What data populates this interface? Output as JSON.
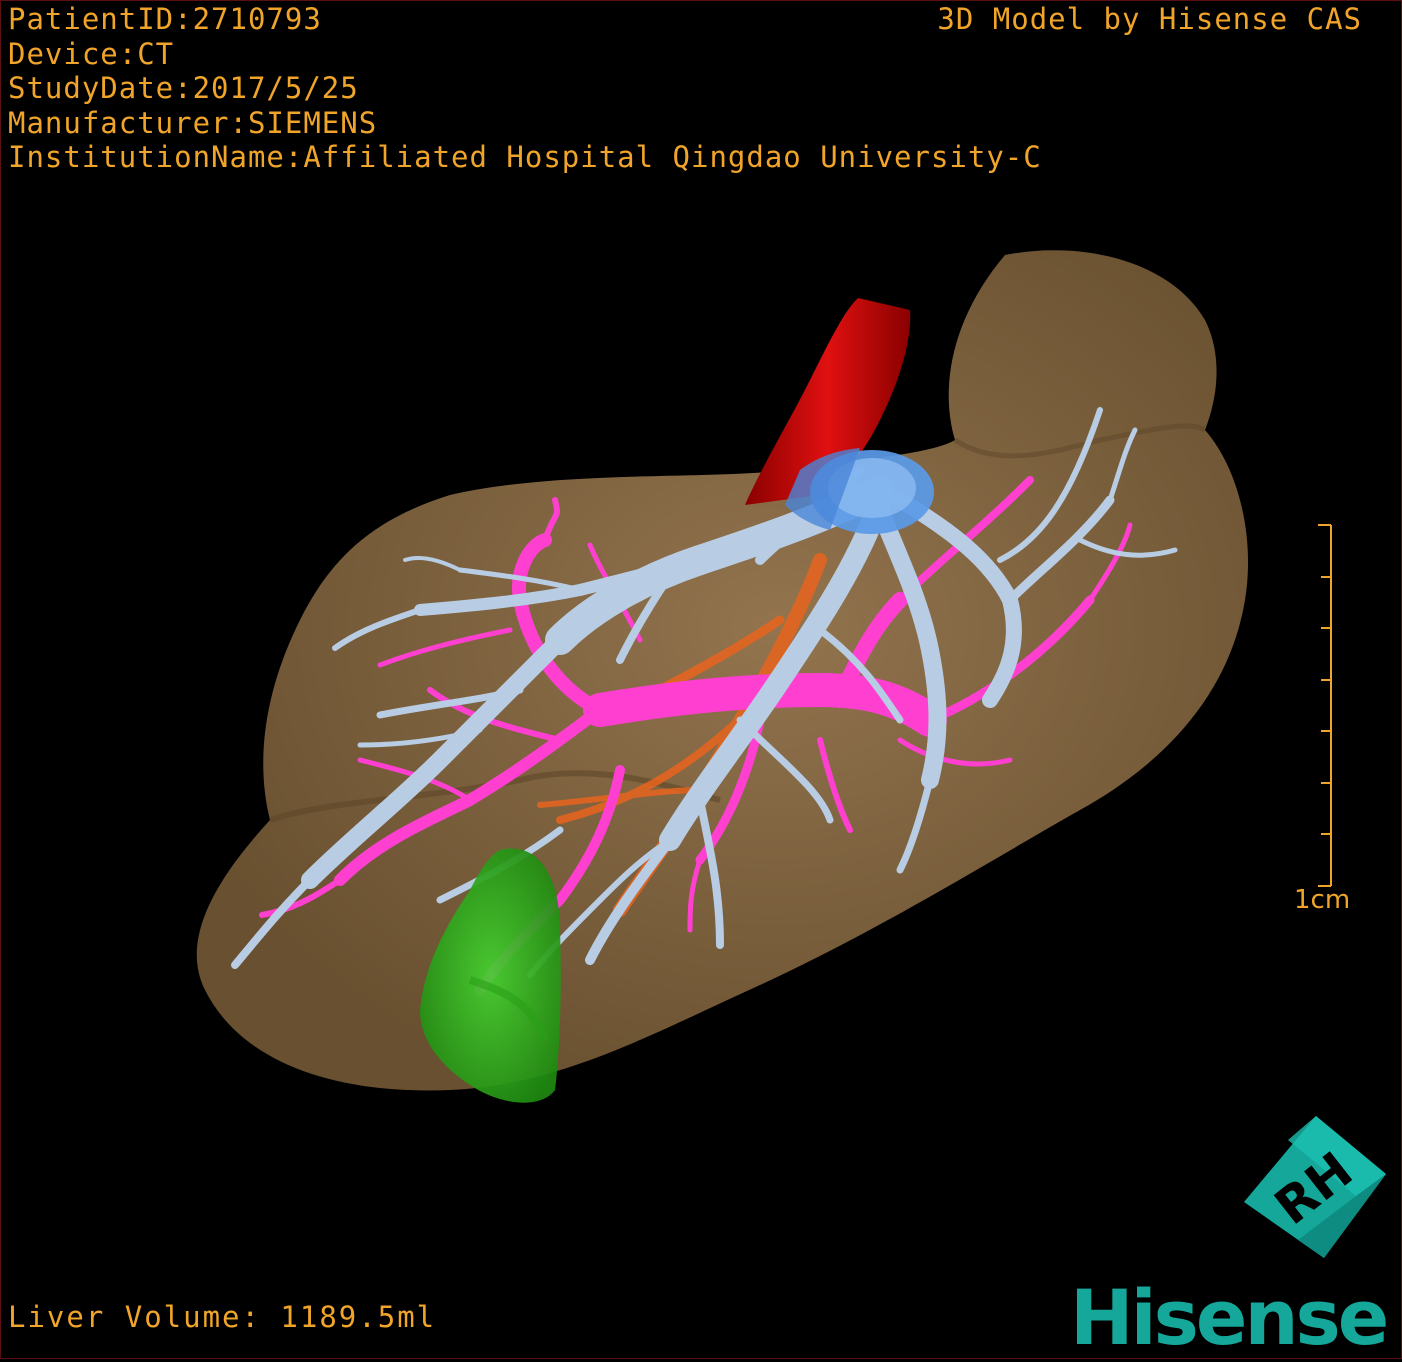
{
  "overlay": {
    "patient_id": "PatientID:2710793",
    "device": "Device:CT",
    "study_date": "StudyDate:2017/5/25",
    "manufacturer": "Manufacturer:SIEMENS",
    "institution": "InstitutionName:Affiliated Hospital Qingdao University-C",
    "credit": "3D Model by Hisense CAS",
    "liver_volume": "Liver Volume: 1189.5ml"
  },
  "scale_bar": {
    "label": "1cm"
  },
  "orientation_cube": {
    "face_letters": "RH"
  },
  "brand": {
    "logo_text": "Hisense"
  },
  "colors": {
    "overlay_text": "#f0a52a",
    "liver": "#8a6a44",
    "hepatic_vein": "#b8cde4",
    "portal_vein": "#ff3fd0",
    "artery": "#c80a0a",
    "vena_cava": "#5a9ae8",
    "gallbladder": "#3cc828",
    "bile_duct": "#e8641e",
    "brand": "#14a79a"
  }
}
